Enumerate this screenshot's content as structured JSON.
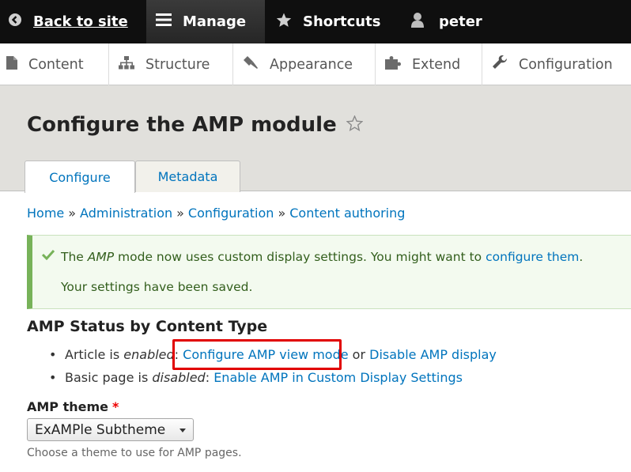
{
  "toolbar": {
    "back_label": "Back to site",
    "manage_label": "Manage",
    "shortcuts_label": "Shortcuts",
    "user_label": "peter"
  },
  "tray": {
    "items": [
      {
        "label": "Content",
        "icon": "file-icon"
      },
      {
        "label": "Structure",
        "icon": "sitemap-icon"
      },
      {
        "label": "Appearance",
        "icon": "paintbrush-icon"
      },
      {
        "label": "Extend",
        "icon": "puzzle-icon"
      },
      {
        "label": "Configuration",
        "icon": "wrench-icon"
      }
    ]
  },
  "page": {
    "title": "Configure the AMP module",
    "tabs": [
      {
        "label": "Configure",
        "active": true
      },
      {
        "label": "Metadata",
        "active": false
      }
    ]
  },
  "breadcrumb": {
    "items": [
      "Home",
      "Administration",
      "Configuration",
      "Content authoring"
    ],
    "separator": "»"
  },
  "message": {
    "line1_prefix": "The ",
    "line1_em": "AMP",
    "line1_middle": " mode now uses custom display settings. You might want to ",
    "line1_link": "configure them",
    "line1_suffix": ".",
    "line2": "Your settings have been saved."
  },
  "status": {
    "title": "AMP Status by Content Type",
    "article_prefix": "Article is ",
    "article_state": "enabled",
    "article_colon": ": ",
    "article_link1": "Configure AMP view mode",
    "article_or": " or ",
    "article_link2": "Disable AMP display",
    "basic_prefix": "Basic page is ",
    "basic_state": "disabled",
    "basic_colon": ": ",
    "basic_link": "Enable AMP in Custom Display Settings"
  },
  "theme_field": {
    "label": "AMP theme",
    "required_mark": "*",
    "selected": "ExAMPle Subtheme",
    "description": "Choose a theme to use for AMP pages."
  },
  "colors": {
    "link": "#0074bd",
    "highlight": "#e10000",
    "success_border": "#77b259"
  }
}
